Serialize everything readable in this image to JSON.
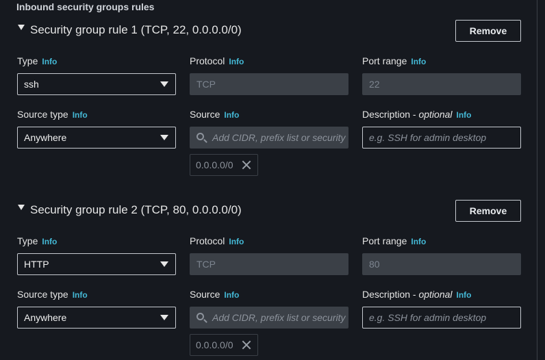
{
  "section": {
    "title": "Inbound security groups rules"
  },
  "labels": {
    "type": "Type",
    "protocol": "Protocol",
    "port_range": "Port range",
    "source_type": "Source type",
    "source": "Source",
    "description": "Description - ",
    "description_optional": "optional",
    "info": "Info"
  },
  "rules": [
    {
      "title": "Security group rule 1 (TCP, 22, 0.0.0.0/0)",
      "remove_label": "Remove",
      "type_value": "ssh",
      "protocol_value": "TCP",
      "port_value": "22",
      "source_type_value": "Anywhere",
      "source_placeholder": "Add CIDR, prefix list or security",
      "description_placeholder": "e.g. SSH for admin desktop",
      "token": "0.0.0.0/0"
    },
    {
      "title": "Security group rule 2 (TCP, 80, 0.0.0.0/0)",
      "remove_label": "Remove",
      "type_value": "HTTP",
      "protocol_value": "TCP",
      "port_value": "80",
      "source_type_value": "Anywhere",
      "source_placeholder": "Add CIDR, prefix list or security",
      "description_placeholder": "e.g. SSH for admin desktop",
      "token": "0.0.0.0/0"
    }
  ],
  "icons": {
    "caret": "caret-down-icon",
    "dropdown": "chevron-down-icon",
    "search": "search-icon",
    "remove_token": "close-icon"
  },
  "colors": {
    "background": "#16191f",
    "info_link": "#44b9d6",
    "disabled_field": "#3b4047",
    "border": "#c7cbd1"
  }
}
